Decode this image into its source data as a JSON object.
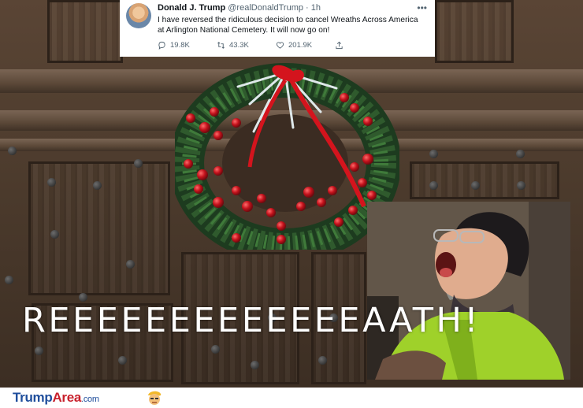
{
  "tweet": {
    "name": "Donald J. Trump",
    "handle": "@realDonaldTrump · 1h",
    "more": "•••",
    "text": "I have reversed the ridiculous decision to cancel Wreaths Across America at Arlington National Cemetery. It will now go on!",
    "replies": "19.8K",
    "retweets": "43.3K",
    "likes": "201.9K"
  },
  "caption": "REEEEEEEEEEEEEAATH!",
  "footer": {
    "logo_part1": "Trump",
    "logo_part2": "Area",
    "logo_part3": ".com"
  },
  "colors": {
    "logo_blue": "#1f4e9c",
    "logo_red": "#c8202c",
    "door_wood": "#4b3a2c",
    "jacket_green": "#9fd12a"
  }
}
